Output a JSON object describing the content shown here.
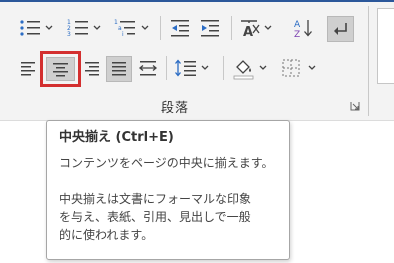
{
  "ribbon": {
    "group_label": "段落",
    "selected_button": "align-center",
    "colors": {
      "highlight_outline": "#d32f2f",
      "icon_blue": "#2b6cc4",
      "icon_gray": "#444444"
    }
  },
  "tooltip": {
    "title": "中央揃え (Ctrl+E)",
    "line1": "コンテンツをページの中央に揃えます。",
    "line2": "中央揃えは文書にフォーマルな印象",
    "line3": "を与え、表紙、引用、見出しで一般",
    "line4": "的に使われます。"
  }
}
